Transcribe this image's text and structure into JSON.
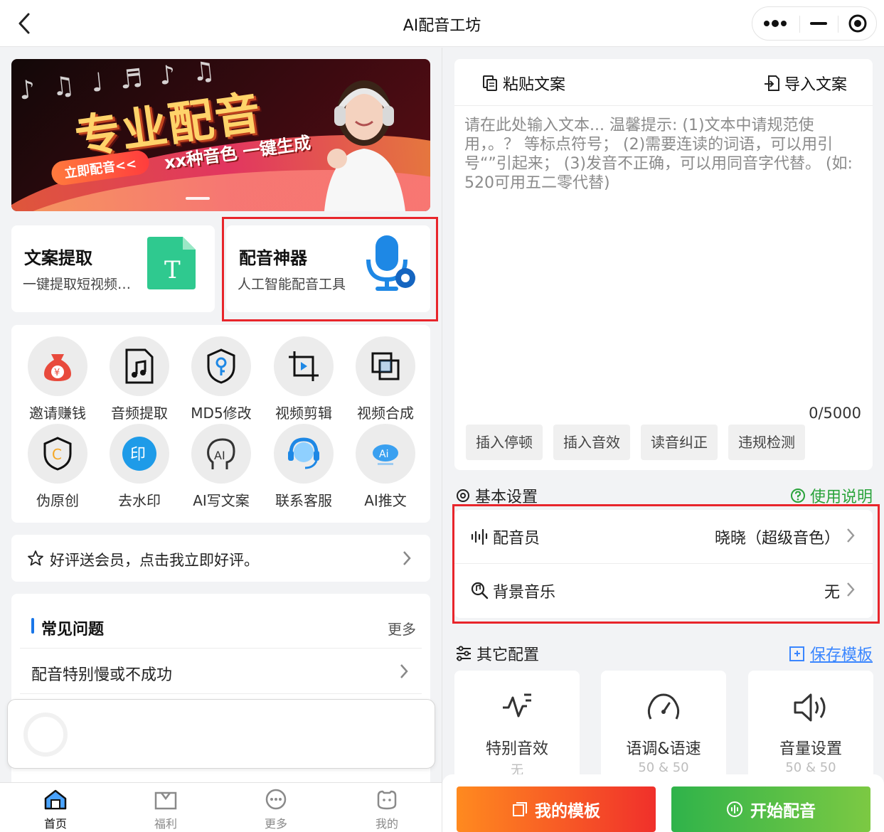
{
  "header": {
    "title": "AI配音工坊"
  },
  "banner": {
    "headline": "专业配音",
    "tagline": "xx种音色 一键生成",
    "cta": "立即配音<<",
    "notes": "♪ ♫ ♩ ♬ ♪ ♫"
  },
  "features": [
    {
      "title": "文案提取",
      "subtitle": "一键提取短视频文案",
      "icon_letter": "T"
    },
    {
      "title": "配音神器",
      "subtitle": "人工智能配音工具"
    }
  ],
  "tools": [
    {
      "label": "邀请赚钱",
      "icon": "money-bag-icon"
    },
    {
      "label": "音频提取",
      "icon": "music-file-icon"
    },
    {
      "label": "MD5修改",
      "icon": "shield-key-icon"
    },
    {
      "label": "视频剪辑",
      "icon": "crop-video-icon"
    },
    {
      "label": "视频合成",
      "icon": "merge-icon"
    },
    {
      "label": "伪原创",
      "icon": "shield-c-icon"
    },
    {
      "label": "去水印",
      "icon": "watermark-icon"
    },
    {
      "label": "AI写文案",
      "icon": "ai-head-icon"
    },
    {
      "label": "联系客服",
      "icon": "headset-icon"
    },
    {
      "label": "AI推文",
      "icon": "ai-cloud-icon"
    }
  ],
  "tool_badges": {
    "money": "¥",
    "watermark": "印",
    "ai_head": "AI",
    "ai_cloud": "Ai",
    "shield_c": "C"
  },
  "review": {
    "text": "好评送会员，点击我立即好评。"
  },
  "faq": {
    "heading": "常见问题",
    "more": "更多",
    "items": [
      "配音特别慢或不成功"
    ]
  },
  "tabbar": [
    {
      "label": "首页",
      "icon": "home-icon",
      "active": true
    },
    {
      "label": "福利",
      "icon": "gift-icon",
      "active": false
    },
    {
      "label": "更多",
      "icon": "more-icon",
      "active": false
    },
    {
      "label": "我的",
      "icon": "profile-icon",
      "active": false
    }
  ],
  "editor": {
    "paste_label": "粘贴文案",
    "import_label": "导入文案",
    "placeholder": "请在此处输入文本... 温馨提示: (1)文本中请规范使用，。？ 等标点符号； (2)需要连读的词语，可以用引号“”引起来； (3)发音不正确，可以用同音字代替。 (如: 520可用五二零代替)",
    "count": "0/5000",
    "chips": [
      "插入停顿",
      "插入音效",
      "读音纠正",
      "违规检测"
    ]
  },
  "basic_settings": {
    "title": "基本设置",
    "help": "使用说明",
    "rows": [
      {
        "label": "配音员",
        "value": "晓晓（超级音色）"
      },
      {
        "label": "背景音乐",
        "value": "无"
      }
    ]
  },
  "other_settings": {
    "title": "其它配置",
    "save_template": "保存模板",
    "cards": [
      {
        "label": "特别音效",
        "value": "无"
      },
      {
        "label": "语调&语速",
        "value": "50 & 50"
      },
      {
        "label": "音量设置",
        "value": "50 & 50"
      }
    ]
  },
  "actions": {
    "my_templates": "我的模板",
    "start": "开始配音"
  },
  "colors": {
    "accent_green": "#2aa33b",
    "link_blue": "#3a86ff",
    "highlight_red": "#e8252b",
    "orange_start": "#ff8a1f",
    "orange_end": "#f0302b",
    "green_start": "#2fb34a",
    "green_end": "#7cc943",
    "mic_blue": "#1e88e5",
    "t_green": "#2fc98f"
  }
}
